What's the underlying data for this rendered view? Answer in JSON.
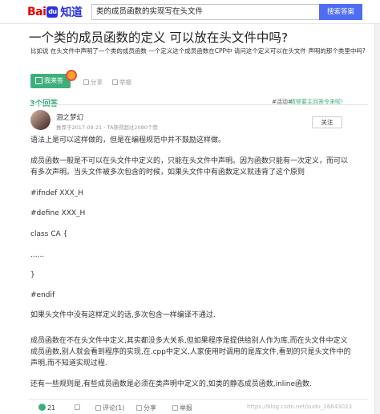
{
  "header": {
    "logo_part1": "Bai",
    "logo_paw": "du",
    "logo_part2": "知道",
    "search_value": "类的成员函数的实现写在头文件",
    "search_button": "搜索答案"
  },
  "question": {
    "title": "一个类的成员函数的定义 可以放在头文件中吗?",
    "description": "比如说 在头文件中声明了一个类的成员函数 一个定义这个成员函数在CPP中 请问这个定义可以在头文件 声明的那个类里中吗?",
    "answer_button": "我来答",
    "share": "分享",
    "report": "举报"
  },
  "answers_header": {
    "count": "3个回答",
    "activity_tag": "#活动#",
    "activity_link": "情够要主回答令来啦!"
  },
  "answer": {
    "user_name": "泪之梦幻",
    "user_meta": "推荐于2017-09-21 · TA获得超过2080个赞",
    "follow": "关注",
    "lines": [
      "语法上是可以这样做的，但是在编程规范中并不鼓励这样做。",
      "成员函数一般是不可以在头文件中定义的，只能在头文件中声明。因为函数只能有一次定义，而可以",
      "有多次声明。当头文件被多次包含的时候，如果头文件中有函数定义就违背了这个原则",
      "#ifndef XXX_H",
      "#define XXX_H",
      "class CA {",
      "......",
      "}",
      "#endif",
      "如果头文件中没有这样定义的话,多次包含一样编译不通过.",
      "成员函数在不在头文件中定义,其实都没多大关系,但如果程序是提供给别人作为库,而在头文件中定义",
      "成员函数,别人就会看到程序的实现,在.cpp中定义,人家使用时调用的是库文件,看到的只是头文件中的",
      "声明,而不知道实现过程.",
      "还有一些规则是,有些成员函数是必须在类声明中定义的,如类的静态成员函数,inline函数."
    ]
  },
  "footer": {
    "likes": "21",
    "comments": "评论(1)",
    "share": "分享",
    "report": "举报",
    "watermark": "https://blog.csdn.net/sudu_16643023"
  }
}
